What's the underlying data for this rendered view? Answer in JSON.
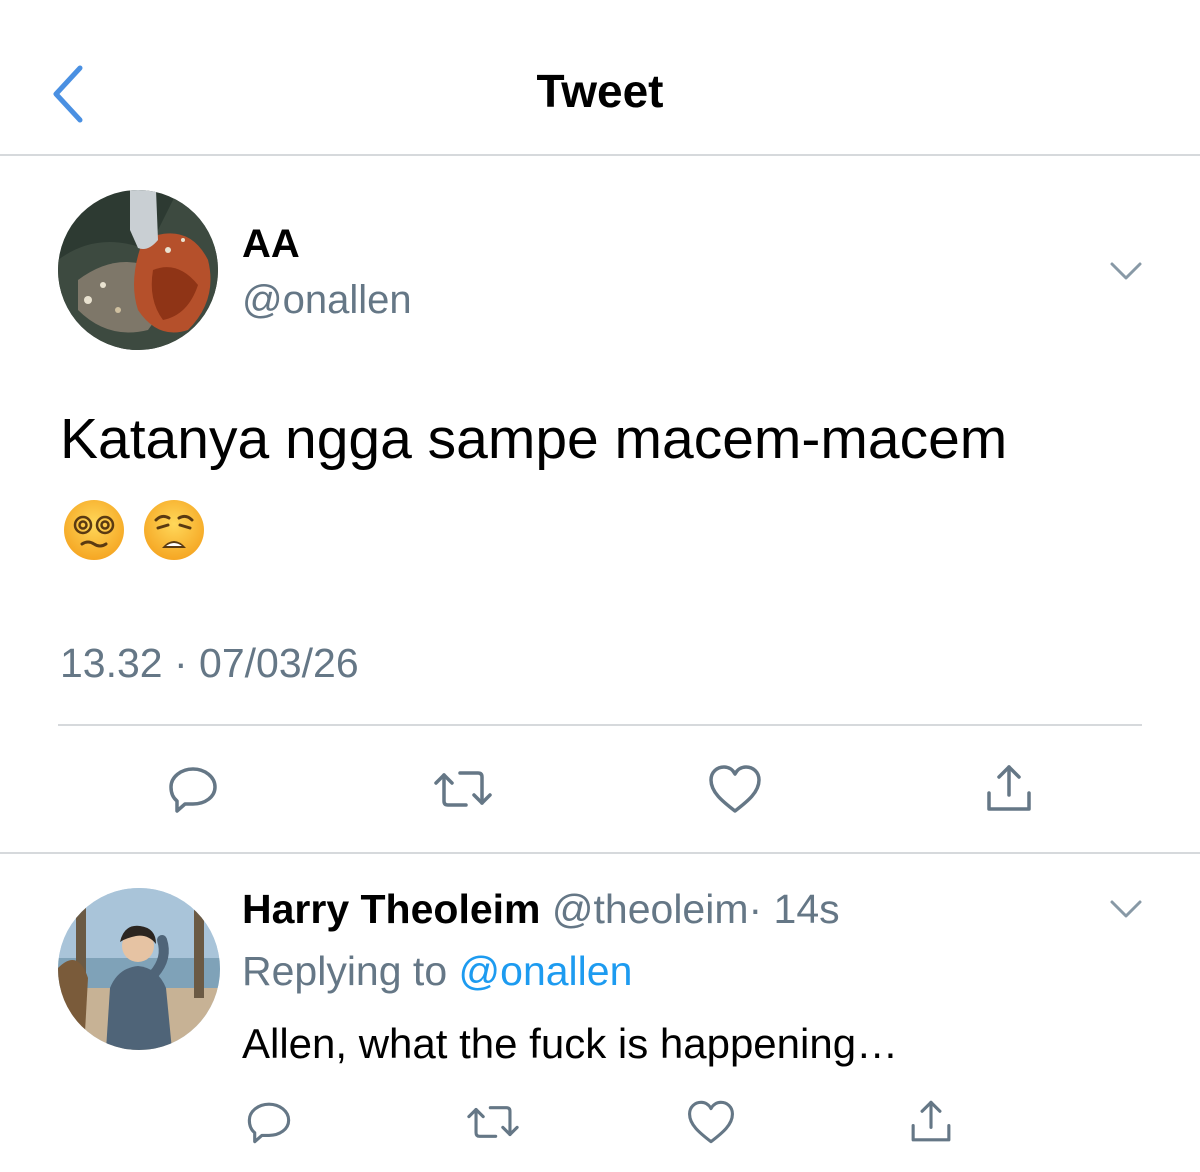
{
  "header": {
    "title": "Tweet"
  },
  "tweet": {
    "display_name": "AA",
    "handle": "@onallen",
    "text": "Katanya ngga sampe macem-macem",
    "emojis": [
      "face-with-spiral-eyes",
      "weary-face"
    ],
    "timestamp": "13.32 · 07/03/26"
  },
  "reply": {
    "display_name": "Harry Theoleim",
    "handle": "@theoleim",
    "time": "· 14s",
    "replying_label": "Replying to",
    "replying_handle": "@onallen",
    "text": "Allen, what the fuck is happening…"
  },
  "colors": {
    "accent": "#1d9bf0",
    "icon": "#657786",
    "divider": "#d6d9dc"
  }
}
